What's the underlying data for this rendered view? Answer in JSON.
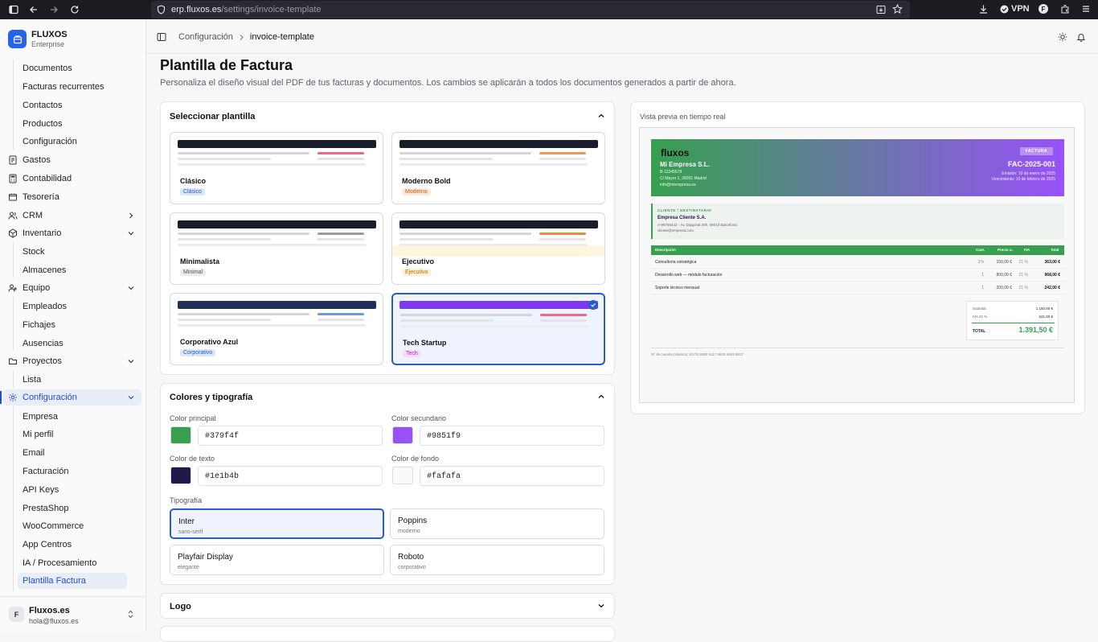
{
  "browser": {
    "url_host": "erp.fluxos.es",
    "url_path": "/settings/invoice-template",
    "vpn_label": "VPN",
    "profile_initial": "F"
  },
  "brand": {
    "name": "FLUXOS",
    "plan": "Enterprise"
  },
  "nav": {
    "docs": [
      "Documentos",
      "Facturas recurrentes",
      "Contactos",
      "Productos",
      "Configuración"
    ],
    "gastos": "Gastos",
    "contabilidad": "Contabilidad",
    "tesoreria": "Tesorería",
    "crm": "CRM",
    "inventario": "Inventario",
    "inventario_sub": [
      "Stock",
      "Almacenes"
    ],
    "equipo": "Equipo",
    "equipo_sub": [
      "Empleados",
      "Fichajes",
      "Ausencias"
    ],
    "proyectos": "Proyectos",
    "proyectos_sub": [
      "Lista"
    ],
    "configuracion": "Configuración",
    "config_sub": [
      "Empresa",
      "Mi perfil",
      "Email",
      "Facturación",
      "API Keys",
      "PrestaShop",
      "WooCommerce",
      "App Centros",
      "IA / Procesamiento",
      "Plantilla Factura"
    ]
  },
  "footer": {
    "avatar": "F",
    "name": "Fluxos.es",
    "email": "hola@fluxos.es"
  },
  "header": {
    "crumb_parent": "Configuración",
    "crumb_current": "invoice-template"
  },
  "page": {
    "title": "Plantilla de Factura",
    "description": "Personaliza el diseño visual del PDF de tus facturas y documentos. Los cambios se aplicarán a todos los documentos generados a partir de ahora."
  },
  "select": {
    "title": "Seleccionar plantilla"
  },
  "templates": [
    {
      "name": "Clásico",
      "tag": "Clásico",
      "bar": "#1a1d2b",
      "accent": "#f06a8a",
      "tagbg": "#dbe6fb",
      "tagfg": "#2a55b8",
      "fade": ""
    },
    {
      "name": "Moderno Bold",
      "tag": "Moderno",
      "bar": "#1a1d2b",
      "accent": "#f29a4b",
      "tagbg": "#fde7d6",
      "tagfg": "#c45a10",
      "fade": ""
    },
    {
      "name": "Minimalista",
      "tag": "Minimal",
      "bar": "#1a1d2b",
      "accent": "#9b9b9f",
      "tagbg": "#ececee",
      "tagfg": "#555",
      "fade": ""
    },
    {
      "name": "Ejecutivo",
      "tag": "Ejecutivo",
      "bar": "#1a1d2b",
      "accent": "#e1913e",
      "tagbg": "#fdf0d4",
      "tagfg": "#b3700e",
      "fade": "#fdf5de"
    },
    {
      "name": "Corporativo Azul",
      "tag": "Corporativo",
      "bar": "#1f2f55",
      "accent": "#6b98e6",
      "tagbg": "#dbe6fb",
      "tagfg": "#2a55b8",
      "fade": ""
    },
    {
      "name": "Tech Startup",
      "tag": "Tech",
      "bar": "#7c3aed",
      "accent": "#f06a8a",
      "tagbg": "#f3ddf6",
      "tagfg": "#b02ab5",
      "fade": "",
      "selected": true
    }
  ],
  "colors": {
    "title": "Colores y tipografía",
    "primary_label": "Color principal",
    "primary": "#379f4f",
    "secondary_label": "Color secundario",
    "secondary": "#9851f9",
    "text_label": "Color de texto",
    "text": "#1e1b4b",
    "bg_label": "Color de fondo",
    "bg": "#fafafa",
    "typo_label": "Tipografía",
    "fonts": [
      {
        "name": "Inter",
        "desc": "sans-serif",
        "selected": true
      },
      {
        "name": "Poppins",
        "desc": "moderno"
      },
      {
        "name": "Playfair Display",
        "desc": "elegante"
      },
      {
        "name": "Roboto",
        "desc": "corporativo"
      }
    ]
  },
  "logo": {
    "title": "Logo"
  },
  "preview": {
    "label": "Vista previa en tiempo real",
    "logo": "fluxos",
    "company": "Mi Empresa S.L.",
    "nif": "B-12345678",
    "address": "C/ Mayor 1, 28001 Madrid",
    "email": "info@miempresa.es",
    "badge": "FACTURA",
    "number": "FAC-2025-001",
    "issue": "Emisión: 10 de enero de 2025",
    "due": "Vencimiento: 10 de febrero de 2025",
    "client_label": "CLIENTE / DESTINATARIO",
    "client": "Empresa Cliente S.A.",
    "client_addr": "A-98765432 · Av. Diagonal 200, 08013 Barcelona",
    "client_email": "cliente@empresa.com",
    "cols": [
      "Descripción",
      "Cant.",
      "Precio u.",
      "IVA",
      "Total"
    ],
    "rows": [
      {
        "d": "Consultoría estratégica",
        "q": "2 h",
        "p": "150,00 €",
        "i": "21 %",
        "t": "363,00 €"
      },
      {
        "d": "Desarrollo web — módulo facturación",
        "q": "1",
        "p": "800,00 €",
        "i": "21 %",
        "t": "968,00 €"
      },
      {
        "d": "Soporte técnico mensual",
        "q": "1",
        "p": "200,00 €",
        "i": "21 %",
        "t": "242,00 €"
      }
    ],
    "subtotal_label": "Subtotal",
    "subtotal": "1.150,00 €",
    "iva_label": "IVA 21 %",
    "iva": "241,50 €",
    "total_label": "TOTAL",
    "total": "1.391,50 €",
    "iban": "Nº de cuenta (Abanca): ES76 2080 5117 9830 4003 8817"
  }
}
